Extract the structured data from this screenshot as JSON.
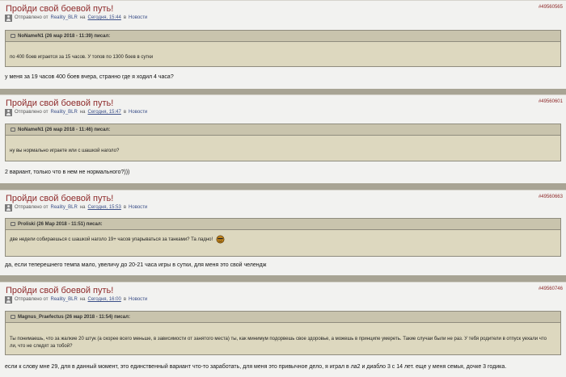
{
  "posts": [
    {
      "title": "Пройди свой боевой путь!",
      "id": "#49560565",
      "meta_prefix": "Отправлено от",
      "author": "Reality_BLR",
      "on": "на",
      "date": "Сегодня, 15:44",
      "in": "в",
      "category": "Новости",
      "quote_header": "NoNameN1 (26 мар 2018 - 11:39) писал:",
      "quote_body": "по 400 боев играется за 15 часов. У топов по 1300 боев в сутки",
      "text": "у меня за 19 часов 400 боев вчера, странно где я ходил 4 часа?"
    },
    {
      "title": "Пройди свой боевой путь!",
      "id": "#49560601",
      "meta_prefix": "Отправлено от",
      "author": "Reality_BLR",
      "on": "на",
      "date": "Сегодня, 15:47",
      "in": "в",
      "category": "Новости",
      "quote_header": "NoNameN1 (26 мар 2018 - 11:46) писал:",
      "quote_body": "ну вы нормально играете или с шашкой наголо?",
      "text": "2 вариант, только что в нем не нормального?)))"
    },
    {
      "title": "Пройди свой боевой путь!",
      "id": "#49560663",
      "meta_prefix": "Отправлено от",
      "author": "Reality_BLR",
      "on": "на",
      "date": "Сегодня, 15:53",
      "in": "в",
      "category": "Новости",
      "quote_header": "Proliski (26 Мар 2018 - 11:51) писал:",
      "quote_body": "две недели  собираешься с шашкой наголо 19+ часов упарываться за танками? Та ладно!",
      "text": "да, если теперешнего темпа мало, увеличу до 20-21 часа игры в сутки, для меня это свой челендж"
    },
    {
      "title": "Пройди свой боевой путь!",
      "id": "#49560746",
      "meta_prefix": "Отправлено от",
      "author": "Reality_BLR",
      "on": "на",
      "date": "Сегодня, 16:00",
      "in": "в",
      "category": "Новости",
      "quote_header": "Magnus_Praefectus (26 мар 2018 - 11:54) писал:",
      "quote_body": "Ты понимаешь, что за жалкие 20 штук (а скорее всего меньше, в зависимости от занятого места) ты, как минимум подорвешь свое здоровье, а можешь в принципе умереть. Такие случаи были не раз. У тебя родители в отпуск уехали что ли, что не следят за тобой?",
      "text": "если к слову мне 29, для в данный момент, это единственный вариант что-то заработать, для меня это привычное дело, я играл в ла2 и диабло 3 с 14 лет. еще у меня семья, дочке 3 годика."
    }
  ]
}
